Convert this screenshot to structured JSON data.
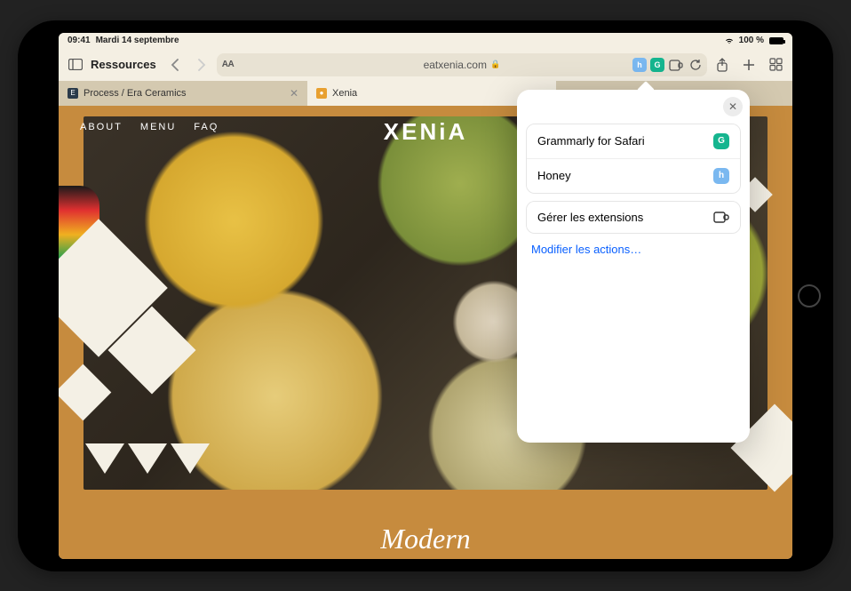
{
  "status": {
    "time": "09:41",
    "date": "Mardi 14 septembre",
    "battery_text": "100 %"
  },
  "toolbar": {
    "sidebar_label": "Ressources",
    "reader_label": "AA",
    "url": "eatxenia.com"
  },
  "tabs": [
    {
      "label": "Process / Era Ceramics",
      "active": false
    },
    {
      "label": "Xenia",
      "active": true
    }
  ],
  "page": {
    "nav": [
      "ABOUT",
      "MENU",
      "FAQ"
    ],
    "logo": "XENiA",
    "headline": "Modern"
  },
  "popover": {
    "items": [
      {
        "label": "Grammarly for Safari",
        "badge": "G",
        "badge_color": "#15b58f"
      },
      {
        "label": "Honey",
        "badge": "h",
        "badge_color": "#7ab8f0"
      }
    ],
    "manage_label": "Gérer les extensions",
    "edit_link": "Modifier les actions…"
  }
}
